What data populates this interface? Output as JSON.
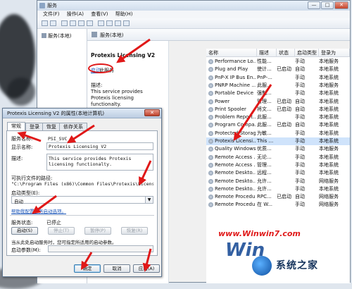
{
  "window": {
    "title": "服务",
    "min": "—",
    "max": "□",
    "close": "✕"
  },
  "menu": [
    "文件(F)",
    "操作(A)",
    "查看(V)",
    "帮助(H)"
  ],
  "tree": {
    "root": "服务(本地)"
  },
  "header": {
    "title": "服务(本地)"
  },
  "desc_panel": {
    "service_name": "Protexis Licensing V2",
    "start_link": "启动",
    "start_suffix": "此服务",
    "desc_label": "描述:",
    "desc_text": "This service provides Protexis licensing functionalty."
  },
  "list": {
    "columns": [
      "名称",
      "描述",
      "状态",
      "启动类型",
      "登录为"
    ],
    "rows": [
      {
        "name": "Performance Lo...",
        "desc": "性能...",
        "status": "",
        "start": "手动",
        "logon": "本地服务"
      },
      {
        "name": "Plug and Play",
        "desc": "使计...",
        "status": "已启动",
        "start": "自动",
        "logon": "本地系统"
      },
      {
        "name": "PnP-X IP Bus En...",
        "desc": "PnP-...",
        "status": "",
        "start": "手动",
        "logon": "本地系统"
      },
      {
        "name": "PNRP Machine ...",
        "desc": "此服...",
        "status": "",
        "start": "手动",
        "logon": "本地服务"
      },
      {
        "name": "Portable Device ...",
        "desc": "强制...",
        "status": "",
        "start": "手动",
        "logon": "本地系统"
      },
      {
        "name": "Power",
        "desc": "管理...",
        "status": "已启动",
        "start": "自动",
        "logon": "本地系统"
      },
      {
        "name": "Print Spooler",
        "desc": "将文...",
        "status": "已启动",
        "start": "自动",
        "logon": "本地系统"
      },
      {
        "name": "Problem Report...",
        "desc": "此服...",
        "status": "",
        "start": "手动",
        "logon": "本地系统"
      },
      {
        "name": "Program Compa...",
        "desc": "此服...",
        "status": "已启动",
        "start": "自动",
        "logon": "本地系统"
      },
      {
        "name": "Protected Storage",
        "desc": "为敏...",
        "status": "",
        "start": "手动",
        "logon": "本地系统"
      },
      {
        "name": "Protexis Licensi...",
        "desc": "This ...",
        "status": "",
        "start": "手动",
        "logon": "本地系统"
      },
      {
        "name": "Quality Windows...",
        "desc": "优质...",
        "status": "",
        "start": "手动",
        "logon": "本地服务"
      },
      {
        "name": "Remote Access ...",
        "desc": "无论...",
        "status": "",
        "start": "手动",
        "logon": "本地系统"
      },
      {
        "name": "Remote Access ...",
        "desc": "管理...",
        "status": "",
        "start": "手动",
        "logon": "本地系统"
      },
      {
        "name": "Remote Deskto...",
        "desc": "远程...",
        "status": "",
        "start": "手动",
        "logon": "本地系统"
      },
      {
        "name": "Remote Deskto...",
        "desc": "允许...",
        "status": "",
        "start": "手动",
        "logon": "网络服务"
      },
      {
        "name": "Remote Deskto...",
        "desc": "允许...",
        "status": "",
        "start": "手动",
        "logon": "本地系统"
      },
      {
        "name": "Remote Procedu...",
        "desc": "RPC...",
        "status": "已启动",
        "start": "自动",
        "logon": "网络服务"
      },
      {
        "name": "Remote Procedu...",
        "desc": "在 W...",
        "status": "",
        "start": "手动",
        "logon": "网络服务"
      }
    ]
  },
  "dialog": {
    "title": "Protexis Licensing V2 的属性(本地计算机)",
    "close": "✕",
    "tabs": [
      "常规",
      "登录",
      "恢复",
      "依存关系"
    ],
    "service_name_label": "服务名称:",
    "service_name_value": "PSI_SVC_2",
    "display_name_label": "显示名称:",
    "display_name_value": "Protexis Licensing V2",
    "desc_label": "描述:",
    "desc_value": "This service provides Protexis licensing functionalty.",
    "path_label": "可执行文件的路径:",
    "path_value": "\"C:\\Program Files (x86)\\Common Files\\Protexis\\License...",
    "start_type_label": "启动类型(E):",
    "start_type_value": "自动",
    "help_link": "帮助我配置服务启动选项。",
    "status_label": "服务状态:",
    "status_value": "已停止",
    "btn_start": "启动(S)",
    "btn_stop": "停止(T)",
    "btn_pause": "暂停(P)",
    "btn_resume": "恢复(R)",
    "start_hint": "当从此处启动服务时，您可指定所适用的启动参数。",
    "params_label": "启动参数(M):",
    "ok": "确定",
    "cancel": "取消",
    "apply": "应用(A)"
  },
  "watermark": {
    "url": "www.Winwin7.com",
    "brand": "系统之家",
    "win": "Win"
  },
  "colors": {
    "accent_red": "#e01818",
    "link_blue": "#1a55b8"
  }
}
